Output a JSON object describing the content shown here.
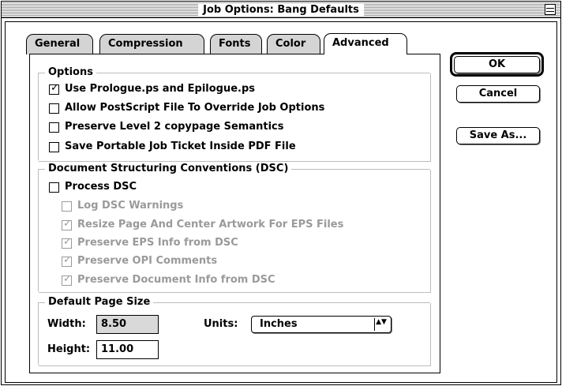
{
  "window": {
    "title": "Job Options: Bang Defaults"
  },
  "tabs": [
    {
      "label": "General",
      "active": false
    },
    {
      "label": "Compression",
      "active": false
    },
    {
      "label": "Fonts",
      "active": false
    },
    {
      "label": "Color",
      "active": false
    },
    {
      "label": "Advanced",
      "active": true
    }
  ],
  "options": {
    "title": "Options",
    "items": [
      {
        "label": "Use Prologue.ps and Epilogue.ps",
        "checked": true,
        "enabled": true,
        "mark": "✓"
      },
      {
        "label": "Allow PostScript File To Override Job Options",
        "checked": false,
        "enabled": true,
        "mark": ""
      },
      {
        "label": "Preserve Level 2 copypage Semantics",
        "checked": false,
        "enabled": true,
        "mark": ""
      },
      {
        "label": "Save Portable Job Ticket Inside PDF File",
        "checked": false,
        "enabled": true,
        "mark": ""
      }
    ]
  },
  "dsc": {
    "title": "Document Structuring Conventions (DSC)",
    "process": {
      "label": "Process DSC",
      "checked": false,
      "enabled": true,
      "mark": ""
    },
    "items": [
      {
        "label": "Log DSC Warnings",
        "checked": false,
        "enabled": false,
        "mark": ""
      },
      {
        "label": "Resize Page And Center Artwork For EPS Files",
        "checked": true,
        "enabled": false,
        "mark": "✓"
      },
      {
        "label": "Preserve EPS Info from DSC",
        "checked": true,
        "enabled": false,
        "mark": "✓"
      },
      {
        "label": "Preserve OPI Comments",
        "checked": true,
        "enabled": false,
        "mark": "✓"
      },
      {
        "label": "Preserve Document Info from DSC",
        "checked": true,
        "enabled": false,
        "mark": "✓"
      }
    ]
  },
  "page_size": {
    "title": "Default Page Size",
    "width_label": "Width:",
    "width_value": "8.50",
    "height_label": "Height:",
    "height_value": "11.00",
    "units_label": "Units:",
    "units_value": "Inches",
    "units_arrow": "▲▼"
  },
  "buttons": {
    "ok": "OK",
    "cancel": "Cancel",
    "save_as": "Save As..."
  },
  "colors": {
    "tab_inactive": "#d4d4d4",
    "disabled_text": "#9a9a9a",
    "field_disabled": "#d9d9d9"
  }
}
